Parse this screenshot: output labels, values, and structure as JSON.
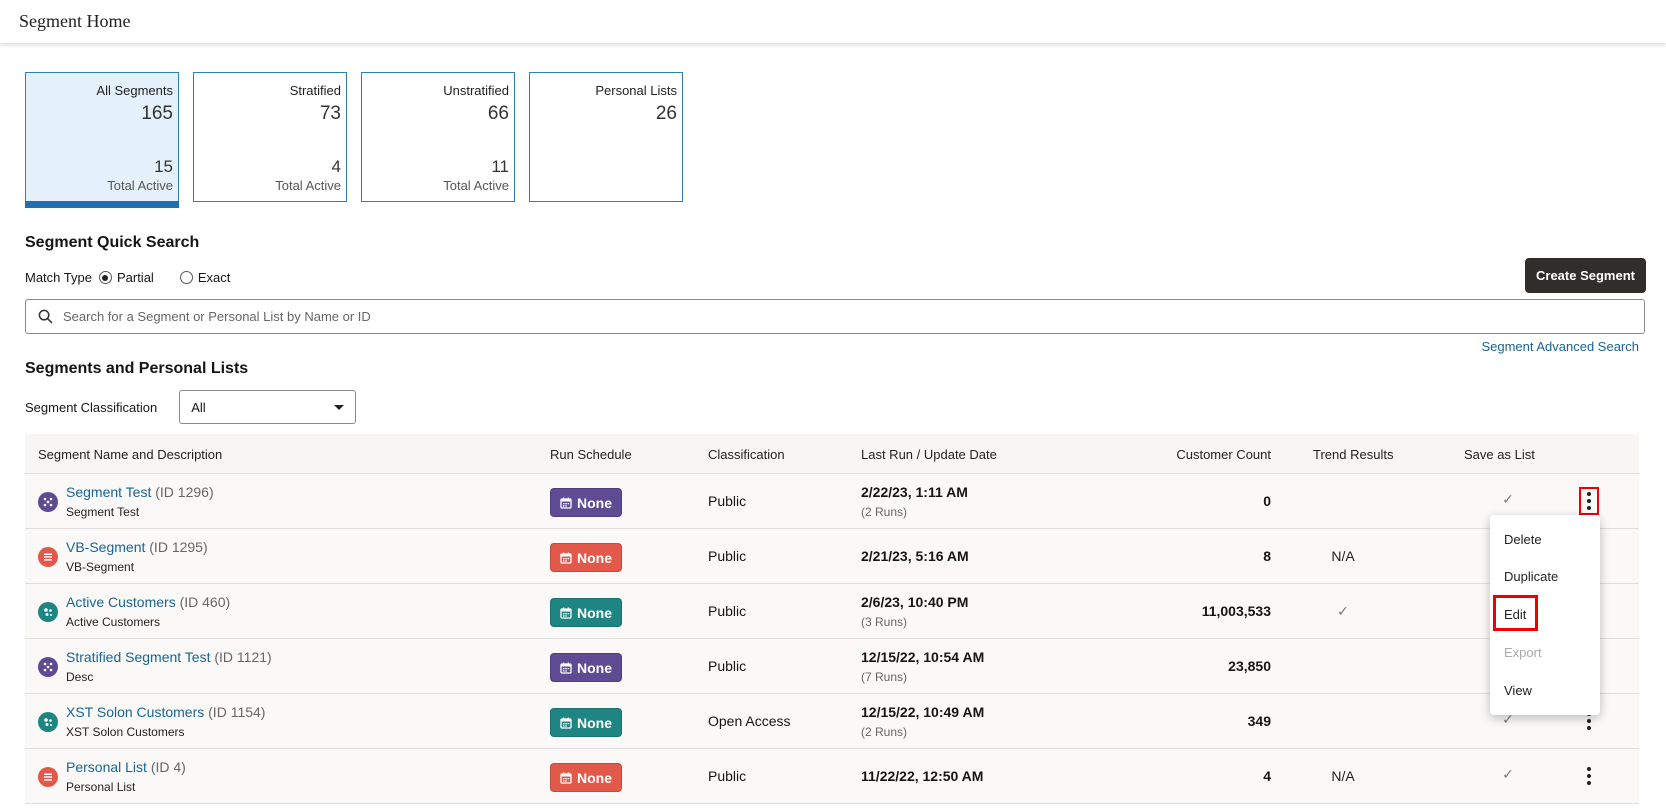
{
  "header": {
    "title": "Segment Home"
  },
  "cards": [
    {
      "label": "All Segments",
      "count": "165",
      "active_count": "15",
      "active_label": "Total Active"
    },
    {
      "label": "Stratified",
      "count": "73",
      "active_count": "4",
      "active_label": "Total Active"
    },
    {
      "label": "Unstratified",
      "count": "66",
      "active_count": "11",
      "active_label": "Total Active"
    },
    {
      "label": "Personal Lists",
      "count": "26"
    }
  ],
  "quick_search": {
    "heading": "Segment Quick Search",
    "match_label": "Match Type",
    "partial": "Partial",
    "exact": "Exact",
    "placeholder": "Search for a Segment or Personal List by Name or ID",
    "create_button": "Create Segment",
    "advanced_link": "Segment Advanced Search"
  },
  "list": {
    "heading": "Segments and Personal Lists",
    "classification_label": "Segment Classification",
    "classification_value": "All",
    "columns": {
      "name": "Segment Name and Description",
      "schedule": "Run Schedule",
      "classification": "Classification",
      "date": "Last Run / Update Date",
      "count": "Customer Count",
      "trend": "Trend Results",
      "save": "Save as List"
    },
    "rows": [
      {
        "name": "Segment Test",
        "id": "(ID 1296)",
        "desc": "Segment Test",
        "schedule": "None",
        "classification": "Public",
        "date": "2/22/23, 1:11 AM",
        "runs": "(2 Runs)",
        "count": "0",
        "trend": "",
        "saved": "✓"
      },
      {
        "name": "VB-Segment",
        "id": "(ID 1295)",
        "desc": "VB-Segment",
        "schedule": "None",
        "classification": "Public",
        "date": "2/21/23, 5:16 AM",
        "runs": "",
        "count": "8",
        "trend": "N/A",
        "saved": ""
      },
      {
        "name": "Active Customers",
        "id": "(ID 460)",
        "desc": "Active Customers",
        "schedule": "None",
        "classification": "Public",
        "date": "2/6/23, 10:40 PM",
        "runs": "(3 Runs)",
        "count": "11,003,533",
        "trend": "✓",
        "saved": ""
      },
      {
        "name": "Stratified Segment Test",
        "id": "(ID 1121)",
        "desc": "Desc",
        "schedule": "None",
        "classification": "Public",
        "date": "12/15/22, 10:54 AM",
        "runs": "(7 Runs)",
        "count": "23,850",
        "trend": "",
        "saved": ""
      },
      {
        "name": "XST Solon Customers",
        "id": "(ID 1154)",
        "desc": "XST Solon Customers",
        "schedule": "None",
        "classification": "Open Access",
        "date": "12/15/22, 10:49 AM",
        "runs": "(2 Runs)",
        "count": "349",
        "trend": "",
        "saved": "✓"
      },
      {
        "name": "Personal List",
        "id": "(ID 4)",
        "desc": "Personal List",
        "schedule": "None",
        "classification": "Public",
        "date": "11/22/22, 12:50 AM",
        "runs": "",
        "count": "4",
        "trend": "N/A",
        "saved": "✓"
      }
    ]
  },
  "context_menu": {
    "items": [
      "Delete",
      "Duplicate",
      "Edit",
      "Export",
      "View"
    ]
  },
  "colors": {
    "purple": "#5f4a94",
    "red": "#e2594a",
    "teal": "#1f8582",
    "link": "#1a6492",
    "card_border": "#2d7fb8"
  }
}
